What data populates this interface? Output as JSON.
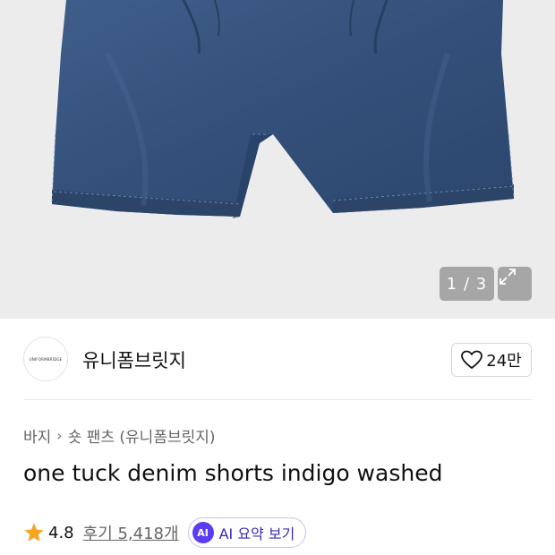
{
  "gallery": {
    "image_label": "denim-shorts-photo",
    "pager_text": "1 / 3"
  },
  "brand": {
    "logo_text": "UNIFORMBRIDGE",
    "name": "유니폼브릿지",
    "like_count": "24만"
  },
  "breadcrumb": {
    "items": [
      "바지",
      "숏 팬츠 (유니폼브릿지)"
    ]
  },
  "product": {
    "title": "one tuck denim shorts indigo washed"
  },
  "rating": {
    "score": "4.8",
    "reviews": "후기 5,418개",
    "ai_badge": "AI",
    "ai_label": "AI 요약 보기"
  },
  "colors": {
    "denim": "#38557f",
    "background": "#ececec",
    "star": "#f5a623",
    "ai_accent": "#5a3df0"
  }
}
